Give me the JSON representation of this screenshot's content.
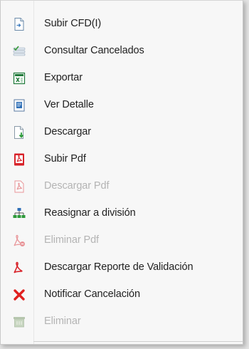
{
  "menu": {
    "items": [
      {
        "label": "Subir CFD(I)",
        "icon": "upload-document-icon",
        "enabled": true
      },
      {
        "label": "Consultar Cancelados",
        "icon": "checked-list-icon",
        "enabled": true
      },
      {
        "label": "Exportar",
        "icon": "excel-export-icon",
        "enabled": true
      },
      {
        "label": "Ver Detalle",
        "icon": "document-detail-icon",
        "enabled": true
      },
      {
        "label": "Descargar",
        "icon": "download-document-icon",
        "enabled": true
      },
      {
        "label": "Subir Pdf",
        "icon": "pdf-upload-icon",
        "enabled": true
      },
      {
        "label": "Descargar Pdf",
        "icon": "pdf-download-icon",
        "enabled": false
      },
      {
        "label": "Reasignar a división",
        "icon": "org-chart-icon",
        "enabled": true
      },
      {
        "label": "Eliminar Pdf",
        "icon": "pdf-delete-icon",
        "enabled": false
      },
      {
        "label": "Descargar Reporte de Validación",
        "icon": "pdf-report-icon",
        "enabled": true
      },
      {
        "label": "Notificar Cancelación",
        "icon": "red-x-icon",
        "enabled": true
      },
      {
        "label": "Eliminar",
        "icon": "trash-icon",
        "enabled": false
      }
    ]
  },
  "colors": {
    "pdf_red": "#d8232a",
    "excel_green": "#1f7a3a",
    "check_green": "#3a9b3a",
    "org_blue": "#2f6fb7",
    "x_red": "#e0201f"
  }
}
